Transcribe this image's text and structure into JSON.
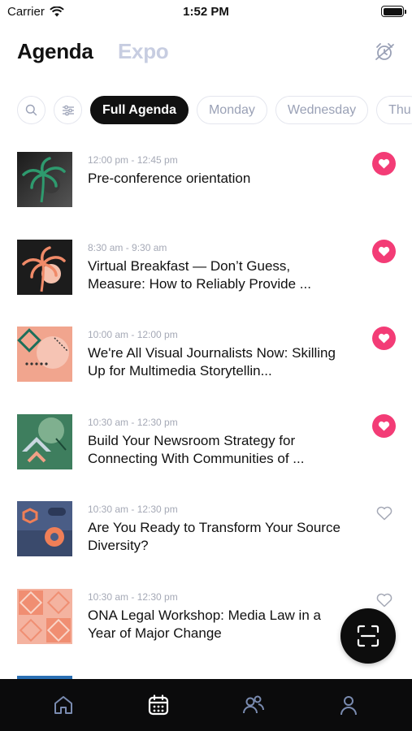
{
  "status_bar": {
    "carrier": "Carrier",
    "time": "1:52 PM"
  },
  "header": {
    "tabs": [
      {
        "label": "Agenda",
        "active": true
      },
      {
        "label": "Expo",
        "active": false
      }
    ]
  },
  "filters": {
    "chips": [
      {
        "label": "Full Agenda",
        "active": true
      },
      {
        "label": "Monday",
        "active": false
      },
      {
        "label": "Wednesday",
        "active": false
      },
      {
        "label": "Thu",
        "active": false
      }
    ]
  },
  "sessions": [
    {
      "time": "12:00 pm - 12:45 pm",
      "title": "Pre-conference orientation",
      "favorited": true
    },
    {
      "time": "8:30 am - 9:30 am",
      "title": "Virtual Breakfast — Don’t Guess, Measure: How to Reliably Provide ...",
      "favorited": true
    },
    {
      "time": "10:00 am - 12:00 pm",
      "title": "We're All Visual Journalists Now: Skilling Up for Multimedia Storytellin...",
      "favorited": true
    },
    {
      "time": "10:30 am - 12:30 pm",
      "title": "Build Your Newsroom Strategy for Connecting With Communities of ...",
      "favorited": true
    },
    {
      "time": "10:30 am - 12:30 pm",
      "title": "Are You Ready to Transform Your Source Diversity?",
      "favorited": false
    },
    {
      "time": "10:30 am - 12:30 pm",
      "title": "ONA Legal Workshop: Media Law in a Year of Major Change",
      "favorited": false
    }
  ],
  "colors": {
    "accent_heart": "#f33c76",
    "inactive_tab": "#c7cde1",
    "tabbar_bg": "#0b0b0c"
  },
  "tabbar": {
    "items": [
      "home-icon",
      "calendar-icon",
      "people-icon",
      "profile-icon"
    ],
    "active": "calendar-icon"
  }
}
